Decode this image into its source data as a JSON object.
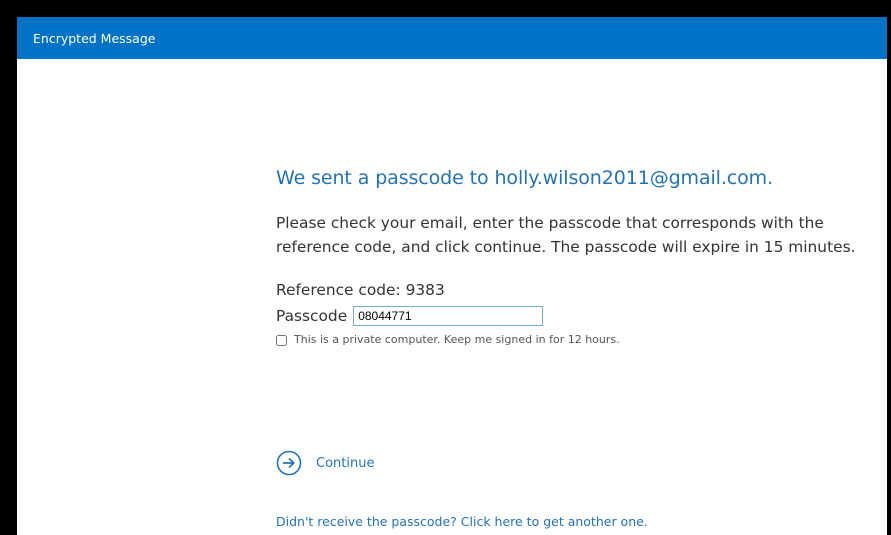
{
  "header": {
    "title": "Encrypted Message"
  },
  "main": {
    "headline": "We sent a passcode to holly.wilson2011@gmail.com.",
    "instructions": "Please check your email, enter the passcode that corresponds with the reference code, and click continue. The passcode will expire in 15 minutes.",
    "reference_code_text": "Reference code: 9383",
    "passcode_label": "Passcode",
    "passcode_value": "08044771",
    "keep_signed_in_label": "This is a private computer. Keep me signed in for 12 hours.",
    "keep_signed_in_checked": false,
    "continue_label": "Continue",
    "continue_icon": "arrow-circle-right-icon",
    "resend_link": "Didn't receive the passcode? Click here to get another one."
  },
  "colors": {
    "header_bg": "#0072c6",
    "accent_text": "#2672b0",
    "body_text": "#333333"
  }
}
